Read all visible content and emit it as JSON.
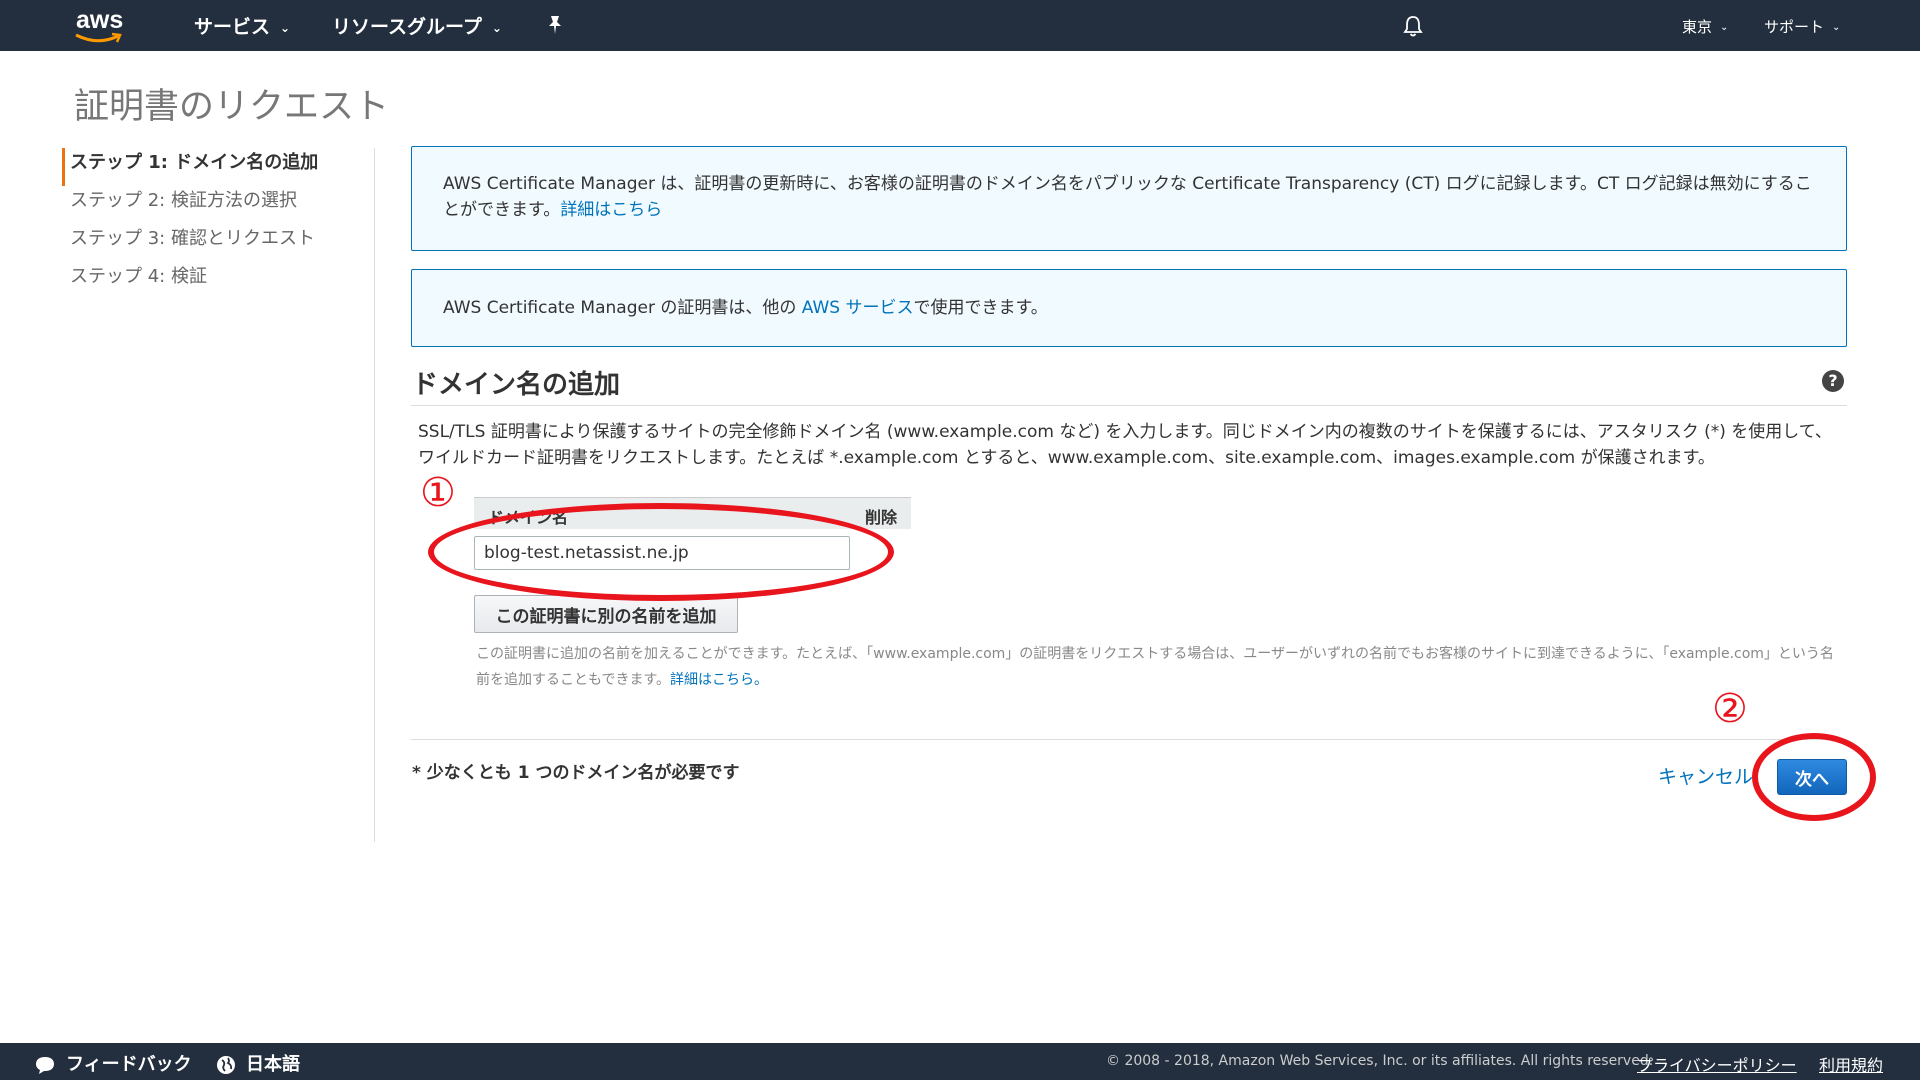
{
  "nav": {
    "logo": "aws",
    "services": "サービス",
    "resource_groups": "リソースグループ",
    "region": "東京",
    "support": "サポート",
    "chevron": "⌄",
    "icons": [
      "pin-icon",
      "bell-icon",
      "chevron-down-icon"
    ]
  },
  "page": {
    "title": "証明書のリクエスト"
  },
  "steps": [
    "ステップ 1: ドメイン名の追加",
    "ステップ 2: 検証方法の選択",
    "ステップ 3: 確認とリクエスト",
    "ステップ 4: 検証"
  ],
  "info1": {
    "text": "AWS Certificate Manager は、証明書の更新時に、お客様の証明書のドメイン名をパブリックな Certificate Transparency (CT) ログに記録します。CT ログ記録は無効にすることができます。",
    "link": "詳細はこちら"
  },
  "info2": {
    "before": "AWS Certificate Manager の証明書は、他の ",
    "link": "AWS サービス",
    "after": "で使用できます。"
  },
  "section": {
    "title": "ドメイン名の追加",
    "help": "?",
    "description": "SSL/TLS 証明書により保護するサイトの完全修飾ドメイン名 (www.example.com など) を入力します。同じドメイン内の複数のサイトを保護するには、アスタリスク (*) を使用して、ワイルドカード証明書をリクエストします。たとえば *.example.com とすると、www.example.com、site.example.com、images.example.com が保護されます。"
  },
  "table": {
    "col_domain": "ドメイン名",
    "col_delete": "削除",
    "domain_value": "blog-test.netassist.ne.jp"
  },
  "add_name_button": "この証明書に別の名前を追加",
  "hint": {
    "text": "この証明書に追加の名前を加えることができます。たとえば、「www.example.com」の証明書をリクエストする場合は、ユーザーがいずれの名前でもお客様のサイトに到達できるように、「example.com」という名前を追加することもできます。",
    "link": "詳細はこちら。"
  },
  "footer_actions": {
    "required_note": "* 少なくとも 1 つのドメイン名が必要です",
    "cancel": "キャンセル",
    "next": "次へ"
  },
  "annotations": {
    "one": "①",
    "two": "②",
    "color": "#e8151d"
  },
  "bottombar": {
    "feedback": "フィードバック",
    "language": "日本語",
    "copyright": "© 2008 - 2018, Amazon Web Services, Inc. or its affiliates. All rights reserved.",
    "privacy": "プライバシーポリシー",
    "terms": "利用規約",
    "icons": [
      "chat-icon",
      "globe-icon"
    ]
  },
  "colors": {
    "nav_bg": "#232f3e",
    "link": "#0073bb",
    "accent": "#ec7211",
    "primary_button": "#1166bb"
  }
}
